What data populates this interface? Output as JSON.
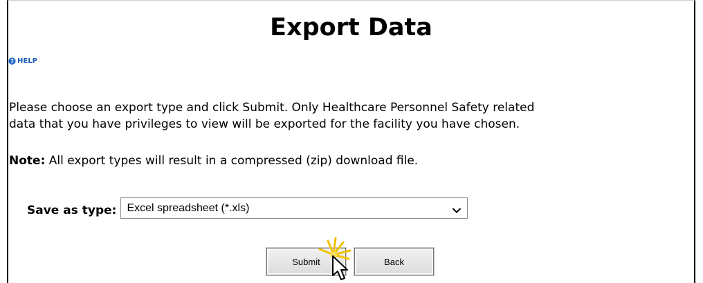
{
  "page": {
    "title": "Export Data",
    "help_label": "HELP"
  },
  "instructions": {
    "intro_line1": "Please choose an export type and click Submit. Only Healthcare Personnel Safety related",
    "intro_line2": "data that you have privileges to view will be exported for the facility you have chosen.",
    "note_label": "Note:",
    "note_text": " All export types will result in a compressed (zip) download file."
  },
  "form": {
    "save_as_label": "Save as type:",
    "save_as_value": "Excel spreadsheet (*.xls)"
  },
  "buttons": {
    "submit_label": "Submit",
    "back_label": "Back"
  },
  "colors": {
    "help_link": "#1f5fb4",
    "click_highlight": "#f2c200"
  },
  "icons": {
    "help": "help-circle-icon",
    "dropdown": "chevron-down-icon",
    "cursor": "mouse-pointer-icon",
    "click": "click-burst-icon"
  }
}
